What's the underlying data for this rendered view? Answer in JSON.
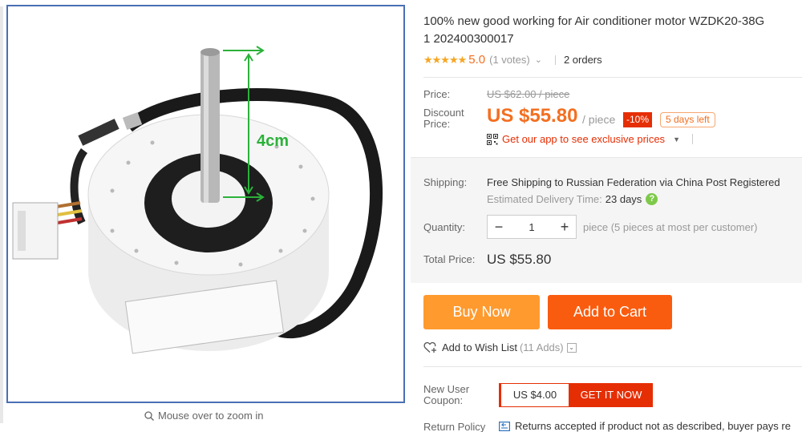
{
  "product": {
    "title_line1": "100% new good working for Air conditioner motor WZDK20-38G",
    "title_line2": "1 202400300017",
    "rating_stars": "★★★★★",
    "rating_value": "5.0",
    "votes": "(1 votes)",
    "orders": "2 orders",
    "image_label": "4cm"
  },
  "zoom_hint": "Mouse over to zoom in",
  "price": {
    "price_label": "Price:",
    "original": "US $62.00 / piece",
    "discount_label_1": "Discount",
    "discount_label_2": "Price:",
    "discount": "US $55.80",
    "per_piece": "/ piece",
    "off_badge": "-10%",
    "days_left": "5 days left",
    "app_promo": "Get our app to see exclusive prices"
  },
  "shipping": {
    "label": "Shipping:",
    "main": "Free Shipping to Russian Federation via China Post Registered",
    "estimated_label": "Estimated Delivery Time:",
    "estimated_days": "23 days"
  },
  "quantity": {
    "label": "Quantity:",
    "value": "1",
    "hint": "piece (5 pieces at most per customer)"
  },
  "total": {
    "label": "Total Price:",
    "value": "US $55.80"
  },
  "actions": {
    "buy_now": "Buy Now",
    "add_to_cart": "Add to Cart",
    "wishlist": "Add to Wish List",
    "wishlist_count": "(11 Adds)"
  },
  "coupon": {
    "label_1": "New User",
    "label_2": "Coupon:",
    "amount": "US $4.00",
    "get_button": "GET IT NOW"
  },
  "return_policy": {
    "label": "Return Policy",
    "text": "Returns accepted if product not as described, buyer pays re"
  },
  "colors": {
    "accent_orange": "#f36f21",
    "buy_now": "#ff9a2e",
    "add_to_cart": "#fa5c0f",
    "badge_red": "#e62e04",
    "star": "#f6a623",
    "image_border": "#4a6fb4"
  }
}
